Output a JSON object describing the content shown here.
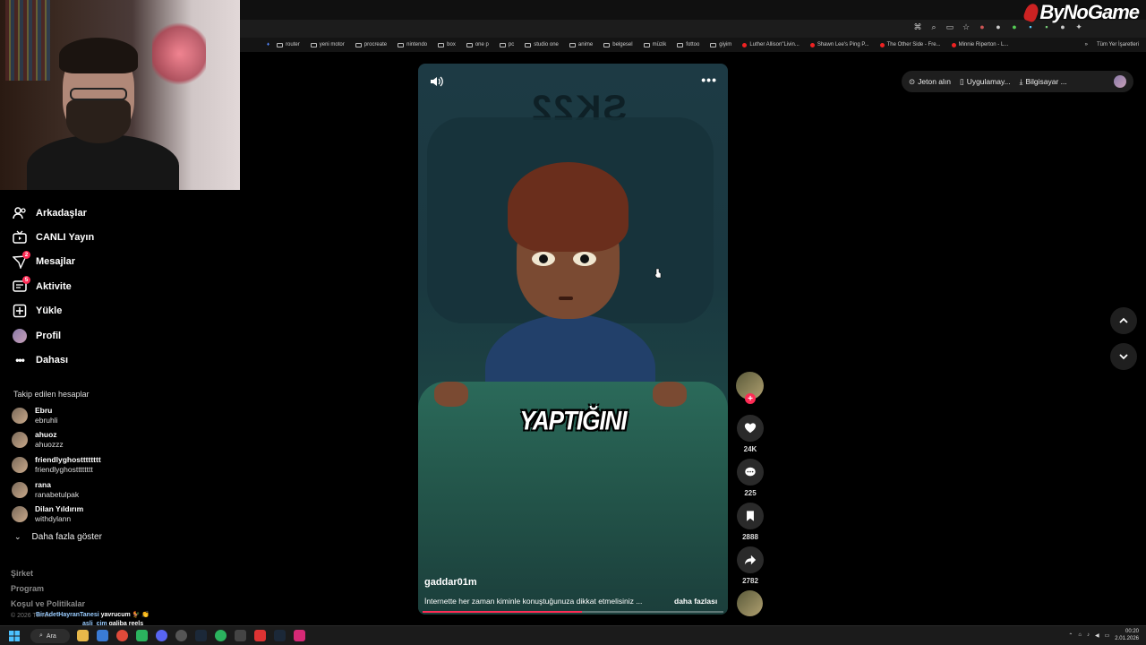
{
  "watermark": "ByNoGame",
  "bookmarks": [
    {
      "label": "router",
      "type": "folder"
    },
    {
      "label": "yeni motor",
      "type": "folder"
    },
    {
      "label": "procreate",
      "type": "folder"
    },
    {
      "label": "nintendo",
      "type": "folder"
    },
    {
      "label": "box",
      "type": "folder"
    },
    {
      "label": "one p",
      "type": "folder"
    },
    {
      "label": "pc",
      "type": "folder"
    },
    {
      "label": "studio one",
      "type": "folder"
    },
    {
      "label": "anime",
      "type": "folder"
    },
    {
      "label": "belgesel",
      "type": "folder"
    },
    {
      "label": "müzik",
      "type": "folder"
    },
    {
      "label": "fottoo",
      "type": "folder"
    },
    {
      "label": "giyim",
      "type": "folder"
    },
    {
      "label": "Luther Allison\"Livin...",
      "type": "youtube"
    },
    {
      "label": "Shawn Lee's Ping P...",
      "type": "youtube"
    },
    {
      "label": "The Other Side - Fre...",
      "type": "youtube"
    },
    {
      "label": "Minnie Riperton - L...",
      "type": "youtube"
    }
  ],
  "bookmarks_more": "»",
  "bookmarks_all": "Tüm Yer İşaretleri",
  "sidebar": {
    "nav": [
      {
        "label": "Arkadaşlar",
        "icon": "friends-icon",
        "badge": ""
      },
      {
        "label": "CANLI Yayın",
        "icon": "live-icon",
        "badge": ""
      },
      {
        "label": "Mesajlar",
        "icon": "messages-icon",
        "badge": "2"
      },
      {
        "label": "Aktivite",
        "icon": "activity-icon",
        "badge": "5"
      },
      {
        "label": "Yükle",
        "icon": "upload-icon",
        "badge": ""
      },
      {
        "label": "Profil",
        "icon": "profile-avatar",
        "badge": ""
      },
      {
        "label": "Dahası",
        "icon": "more-icon",
        "badge": ""
      }
    ],
    "following_title": "Takip edilen hesaplar",
    "following": [
      {
        "name": "Ebru",
        "handle": "ebruhli"
      },
      {
        "name": "ahuoz",
        "handle": "ahuozzz"
      },
      {
        "name": "friendlyghostttttttt",
        "handle": "friendlyghostttttttt"
      },
      {
        "name": "rana",
        "handle": "ranabetulpak"
      },
      {
        "name": "Dilan Yıldırım",
        "handle": "withdylann"
      }
    ],
    "show_more": "Daha fazla göster",
    "footer": [
      "Şirket",
      "Program",
      "Koşul ve Politikalar"
    ],
    "copyright": "© 2026 TikTok"
  },
  "chat": [
    {
      "user": "BirAdetHayranTanesi",
      "msg": "yavrucum 🐓 👏"
    },
    {
      "user": "asli_cim",
      "msg": "galiba reels"
    }
  ],
  "video": {
    "caption": "YAPTIĞINI",
    "watermark_text": "SK22",
    "author": "gaddar01m",
    "description": "İnternette her zaman kiminle konuştuğunuza dikkat etmelisiniz ...",
    "more_link": "daha fazlası",
    "more_dots": "•••",
    "progress": 0.53
  },
  "actions": {
    "likes": "24K",
    "comments": "225",
    "saves": "2888",
    "shares": "2782"
  },
  "topbar": {
    "coins": "Jeton alın",
    "app": "Uygulamay...",
    "desktop": "Bilgisayar ..."
  },
  "taskbar": {
    "search": "Ara",
    "time": "00:20",
    "date": "2.01.2026"
  },
  "colors": {
    "accent": "#fe2c55",
    "background": "#000000"
  }
}
